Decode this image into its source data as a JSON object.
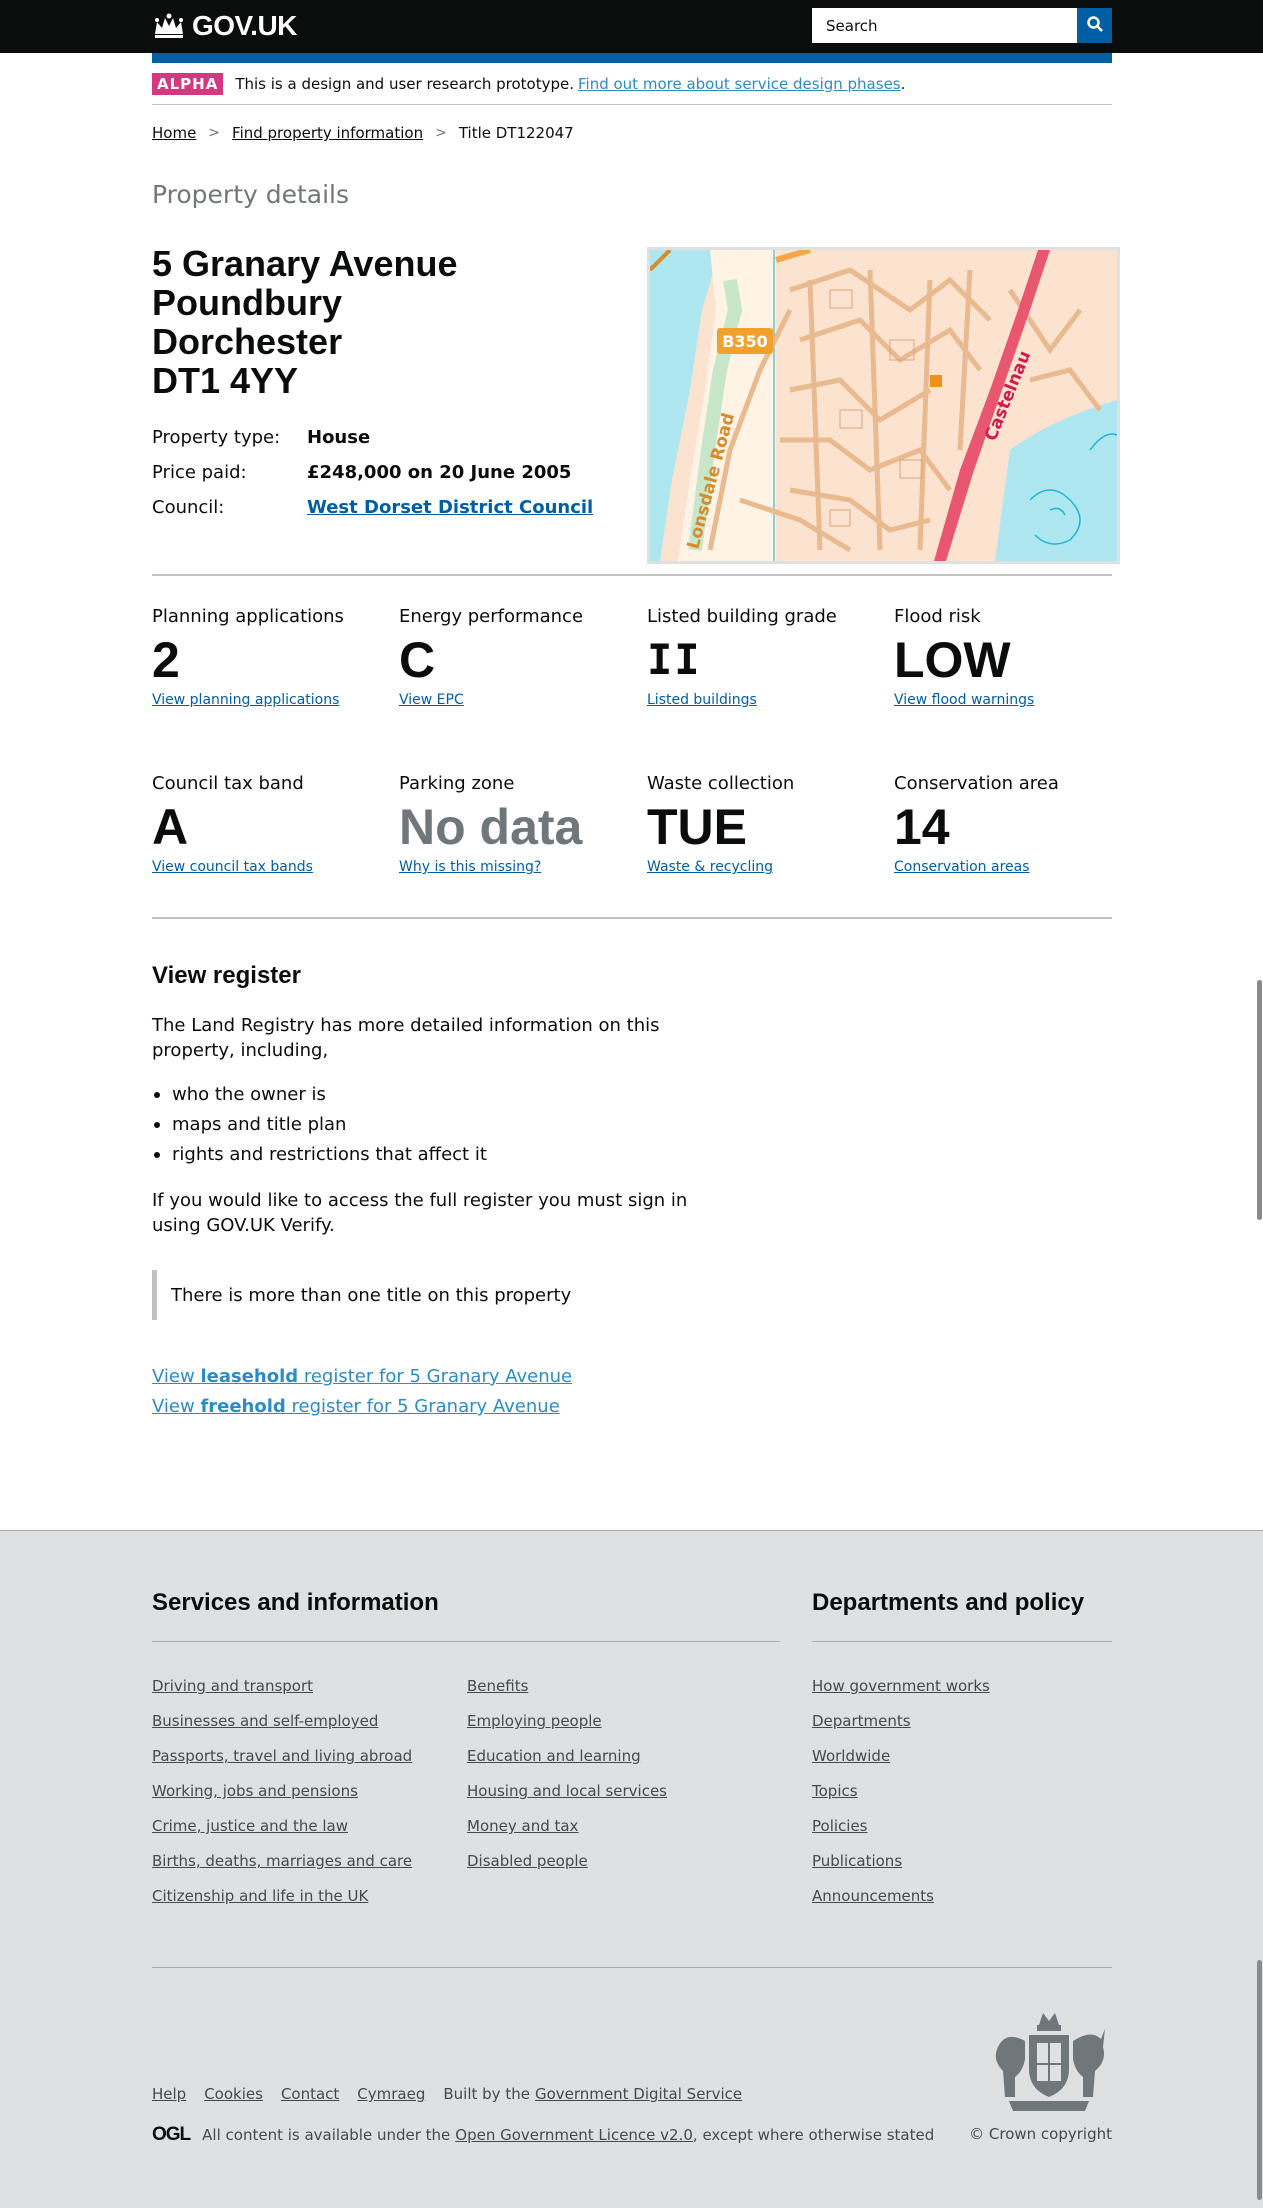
{
  "header": {
    "logo_text": "GOV.UK",
    "search_placeholder": "Search"
  },
  "phase": {
    "tag": "ALPHA",
    "text": "This is a design and user research prototype.",
    "link": "Find out more about service design phases",
    "suffix": "."
  },
  "breadcrumbs": {
    "items": [
      "Home",
      "Find property information"
    ],
    "current": "Title DT122047"
  },
  "page": {
    "caption": "Property details",
    "address": [
      "5 Granary Avenue",
      "Poundbury",
      "Dorchester",
      "DT1 4YY"
    ]
  },
  "facts": [
    {
      "label": "Property type:",
      "value": "House"
    },
    {
      "label": "Price paid:",
      "value": "£248,000 on 20 June 2005"
    },
    {
      "label": "Council:",
      "value": "West Dorset District Council"
    }
  ],
  "map": {
    "road_badge": "B350",
    "road_left": "Lonsdale Road",
    "road_right": "Castelnau"
  },
  "stats": [
    {
      "label": "Planning applications",
      "value": "2",
      "link": "View planning applications"
    },
    {
      "label": "Energy performance",
      "value": "C",
      "link": "View EPC"
    },
    {
      "label": "Listed building grade",
      "value": "II",
      "link": "Listed buildings"
    },
    {
      "label": "Flood risk",
      "value": "LOW",
      "link": "View flood warnings"
    },
    {
      "label": "Council tax band",
      "value": "A",
      "link": "View council tax bands"
    },
    {
      "label": "Parking zone",
      "value": "No data",
      "link": "Why is this missing?"
    },
    {
      "label": "Waste collection",
      "value": "TUE",
      "link": "Waste & recycling"
    },
    {
      "label": "Conservation area",
      "value": "14",
      "link": "Conservation areas"
    }
  ],
  "register": {
    "heading": "View register",
    "intro": "The Land Registry has more detailed information on this property, including,",
    "bullets": [
      "who the owner is",
      "maps and title plan",
      "rights and restrictions that affect it"
    ],
    "signin": "If you would like to access the full register you must sign in using GOV.UK Verify.",
    "inset": "There is more than one title on this property",
    "link1": {
      "pre": "View ",
      "bold": "leasehold",
      "post": " register for 5 Granary Avenue"
    },
    "link2": {
      "pre": "View ",
      "bold": "freehold",
      "post": " register for 5 Granary Avenue"
    }
  },
  "footer": {
    "services_heading": "Services and information",
    "departments_heading": "Departments and policy",
    "services_col1": [
      "Driving and transport",
      "Businesses and self-employed",
      "Passports, travel and living abroad",
      "Working, jobs and pensions",
      "Crime, justice and the law",
      "Births, deaths, marriages and care",
      "Citizenship and life in the UK"
    ],
    "services_col2": [
      "Benefits",
      "Employing people",
      "Education and learning",
      "Housing and local services",
      "Money and tax",
      "Disabled people"
    ],
    "departments": [
      "How government works",
      "Departments",
      "Worldwide",
      "Topics",
      "Policies",
      "Publications",
      "Announcements"
    ],
    "meta_links": [
      "Help",
      "Cookies",
      "Contact",
      "Cymraeg"
    ],
    "built_by": "Built by the",
    "built_by_link": "Government Digital Service",
    "ogl": "OGL",
    "licence_pre": "All content is available under the",
    "licence_link": "Open Government Licence v2.0",
    "licence_post": ", except where otherwise stated",
    "copyright": "© Crown copyright"
  },
  "colors": {
    "header_bg": "#0b0c0c",
    "brand_blue": "#005ea5",
    "alpha_pink": "#d53880",
    "footer_bg": "#dee0e2"
  }
}
